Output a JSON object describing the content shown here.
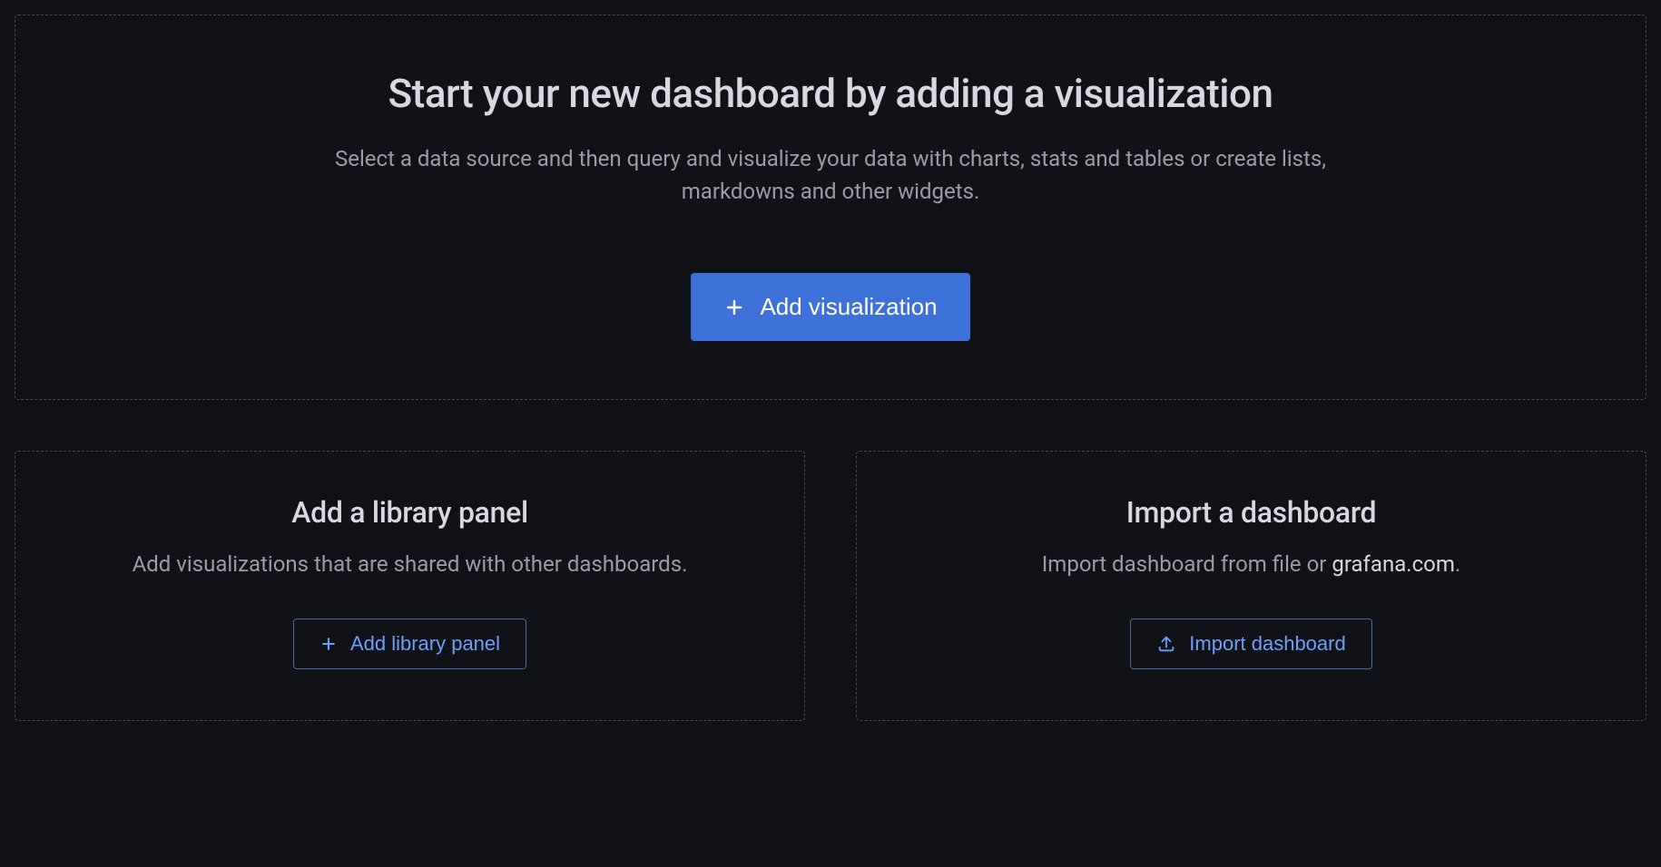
{
  "main": {
    "title": "Start your new dashboard by adding a visualization",
    "description": "Select a data source and then query and visualize your data with charts, stats and tables or create lists, markdowns and other widgets.",
    "button_label": "Add visualization"
  },
  "library": {
    "title": "Add a library panel",
    "description": "Add visualizations that are shared with other dashboards.",
    "button_label": "Add library panel"
  },
  "import": {
    "title": "Import a dashboard",
    "description_prefix": "Import dashboard from file or ",
    "description_link": "grafana.com",
    "description_suffix": ".",
    "button_label": "Import dashboard"
  }
}
